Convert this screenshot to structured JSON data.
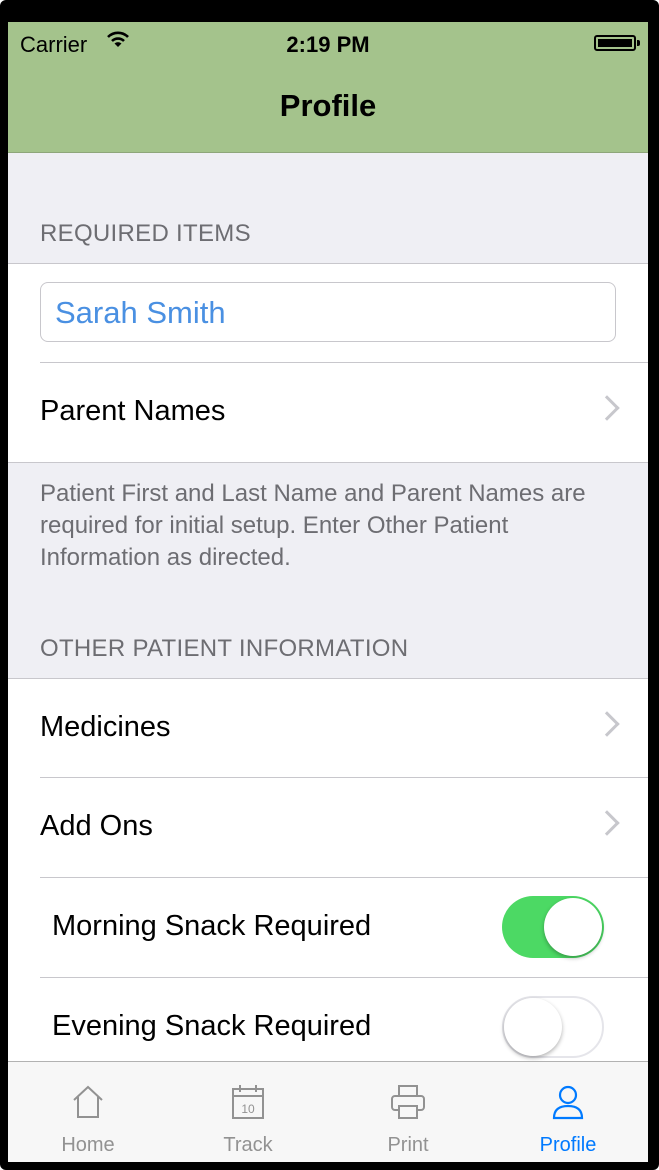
{
  "status_bar": {
    "carrier": "Carrier",
    "time": "2:19 PM"
  },
  "nav": {
    "title": "Profile"
  },
  "required": {
    "header": "REQUIRED ITEMS",
    "name_value": "Sarah Smith",
    "parent_names_label": "Parent Names",
    "footer": "Patient First and Last Name and Parent Names are required for initial setup. Enter Other Patient Information as directed."
  },
  "other": {
    "header": "OTHER PATIENT INFORMATION",
    "medicines_label": "Medicines",
    "add_ons_label": "Add Ons",
    "morning_snack_label": "Morning Snack Required",
    "morning_snack_on": true,
    "evening_snack_label": "Evening Snack Required",
    "evening_snack_on": false
  },
  "tabs": [
    {
      "label": "Home",
      "icon": "home-icon"
    },
    {
      "label": "Track",
      "icon": "calendar-icon",
      "icon_text": "10"
    },
    {
      "label": "Print",
      "icon": "printer-icon"
    },
    {
      "label": "Profile",
      "icon": "person-icon",
      "active": true
    }
  ],
  "colors": {
    "nav_bar": "#a4c38c",
    "accent": "#007aff",
    "toggle_on": "#4cd964",
    "field_text": "#4a90e2"
  }
}
